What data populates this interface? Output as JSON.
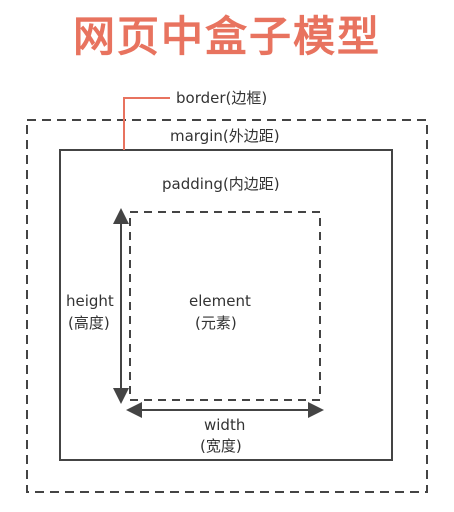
{
  "title": "网页中盒子模型",
  "labels": {
    "border": "border(边框)",
    "margin": "margin(外边距)",
    "padding": "padding(内边距)",
    "element": "element",
    "element_cn": "(元素)",
    "height": "height",
    "height_cn": "(高度)",
    "width": "width",
    "width_cn": "(宽度)"
  },
  "colors": {
    "title": "#e8735f",
    "border_pointer": "#e8735f",
    "box_lines": "#444444",
    "text": "#333333"
  }
}
